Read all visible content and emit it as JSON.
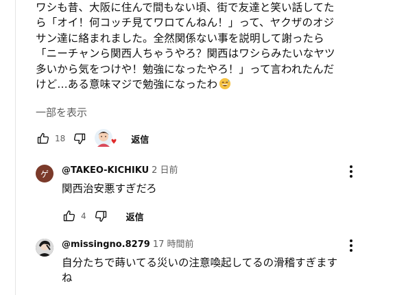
{
  "comment": {
    "lines": [
      "ワシも昔、大阪に住んで間もない頃、街で友達と笑い話してた",
      "ら「オイ！何コッチ見てワロてんねん！」って、ヤクザのオジ",
      "サン達に絡まれました。全然関係ない事を説明して謝ったら",
      "「ニーチャンら関西人ちゃうやろ？関西はワシらみたいなヤツ",
      "多いから気をつけや！勉強になったやろ！」って言われたんだ",
      "けど…ある意味マジで勉強になったわ"
    ],
    "show_more": "一部を表示",
    "like_count": "18",
    "reply_label": "返信"
  },
  "replies": [
    {
      "author": "@TAKEO-KICHIKU",
      "time": "2 日前",
      "avatar_letter": "ゲ",
      "avatar_color": "#7b3a2a",
      "text_lines": [
        "関西治安悪すぎだろ"
      ],
      "like_count": "4",
      "reply_label": "返信"
    },
    {
      "author": "@missingno.8279",
      "time": "17 時間前",
      "text_lines": [
        "自分たちで蒔いてる災いの注意喚起してるの滑稽すぎます",
        "ね"
      ]
    }
  ],
  "icons": {
    "like": "thumbs-up-icon",
    "dislike": "thumbs-down-icon",
    "more": "more-vert-icon",
    "creator_heart": "creator-heart-avatar-icon",
    "emoji": "grinning-sweat-emoji-icon"
  }
}
